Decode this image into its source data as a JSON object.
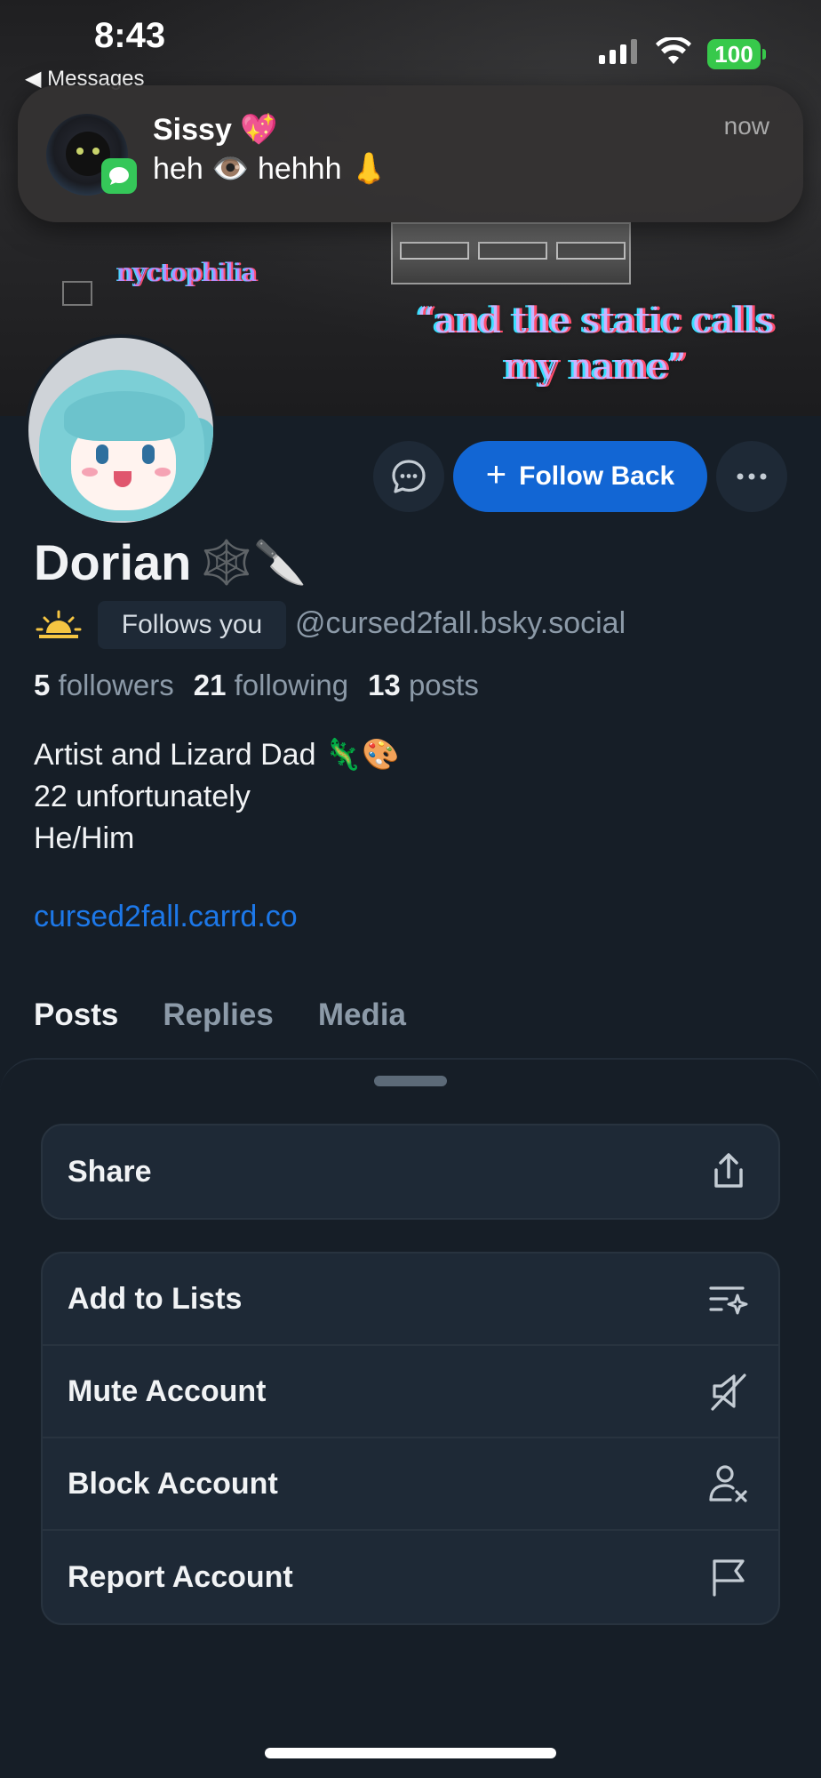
{
  "status_bar": {
    "time": "8:43",
    "back_app": "◀ Messages",
    "battery": "100"
  },
  "notification": {
    "sender": "Sissy 💖",
    "message": "heh 👁️ hehhh 👃",
    "time": "now",
    "app_icon": "messages-icon"
  },
  "banner": {
    "word": "nyctophilia",
    "quote_line1": "“and the static calls",
    "quote_line2": "my name”"
  },
  "profile": {
    "display_name": "Dorian",
    "name_emoji": "🕸️🔪",
    "follows_you": "Follows you",
    "handle": "@cursed2fall.bsky.social",
    "followers_count": "5",
    "followers_label": "followers",
    "following_count": "21",
    "following_label": "following",
    "posts_count": "13",
    "posts_label": "posts",
    "bio_line1": "Artist and Lizard Dad 🦎🎨",
    "bio_line2": "22 unfortunately",
    "bio_line3": "He/Him",
    "link": "cursed2fall.carrd.co",
    "follow_back_label": "Follow Back"
  },
  "tabs": [
    "Posts",
    "Replies",
    "Media"
  ],
  "sheet": {
    "share_label": "Share",
    "items": [
      {
        "label": "Add to Lists",
        "icon": "list-sparkle-icon"
      },
      {
        "label": "Mute Account",
        "icon": "speaker-mute-icon"
      },
      {
        "label": "Block Account",
        "icon": "person-x-icon"
      },
      {
        "label": "Report Account",
        "icon": "flag-icon"
      }
    ]
  },
  "colors": {
    "background": "#161e27",
    "accent": "#1266d4",
    "link": "#1d78e8",
    "muted_text": "#8c9aa8",
    "battery": "#37c94b"
  }
}
